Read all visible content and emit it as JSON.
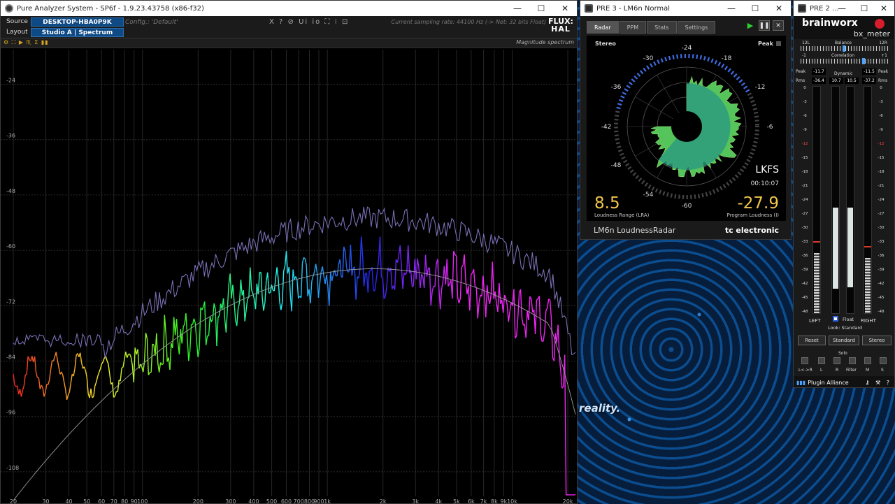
{
  "desktop": {
    "caption": "reality."
  },
  "pure_analyzer": {
    "title": "Pure Analyzer System - SP6f - 1.9.23.43758 (x86-f32)",
    "source_label": "Source",
    "source_value": "DESKTOP-HBA0P9K",
    "layout_label": "Layout",
    "layout_value": "Studio A | Spectrum",
    "config": "Config.: 'Default'",
    "tools": "X ? ⊘ Ui io ⛶ ⁝ ⊡",
    "sampling": "Current sampling rate: 44100 Hz (-> Net: 32 bits Float)",
    "logo_top": "FLUX:",
    "logo_bottom": "HAL",
    "toolbar_icons": "⚙ ⛶ ▶ ♏ Σ ▮▮",
    "mode": "Magnitude spectrum",
    "y_ticks": [
      "-24",
      "-36",
      "-48",
      "-60",
      "-72",
      "-84",
      "-96",
      "-108"
    ],
    "x_ticks": [
      "20",
      "30",
      "40",
      "50",
      "60",
      "70",
      "80",
      "90",
      "100",
      "200",
      "300",
      "400",
      "500",
      "600",
      "700",
      "800",
      "900",
      "1k",
      "2k",
      "3k",
      "4k",
      "5k",
      "6k",
      "7k",
      "8k",
      "9k",
      "10k",
      "20k"
    ]
  },
  "lm6": {
    "title": "PRE 3 - LM6n Normal",
    "tabs": [
      "Radar",
      "PPM",
      "Stats",
      "Settings"
    ],
    "stereo": "Stereo",
    "peak": "Peak",
    "ring_labels": [
      "-24",
      "-18",
      "-12",
      "-6",
      "-30",
      "-36",
      "-42",
      "-48",
      "-54",
      "-60"
    ],
    "unit": "LKFS",
    "time": "00:10:07",
    "lra_value": "8.5",
    "lra_label": "Loudness Range (LRA)",
    "program_value": "-27.9",
    "program_label": "Program Loudness (I)",
    "product": "LM6n LoudnessRadar",
    "brand": "tc electronic"
  },
  "bx": {
    "title": "PRE 2 ...",
    "brand": "brainworx",
    "product": "bx_meter",
    "balance_label": "Balance",
    "balance_left": "12L",
    "balance_right": "12R",
    "correlation_label": "Correlation",
    "corr_left": "-1",
    "corr_right": "+1",
    "peak_label": "Peak",
    "rms_label": "Rms",
    "dynamic_label": "Dynamic",
    "left_peak": "-11.7",
    "right_peak": "-11.5",
    "left_rms": "-36.4",
    "right_rms": "-37.2",
    "dyn_left": "10.7",
    "dyn_right": "10.5",
    "left_label": "LEFT",
    "right_label": "RIGHT",
    "float_label": "Float",
    "look_label": "Look: Standard",
    "btn_reset": "Reset",
    "btn_standard": "Standard",
    "btn_stereo": "Stereo",
    "solo_label": "Solo",
    "solo_items": [
      "L<->R",
      "L",
      "R",
      "Filter",
      "M",
      "S"
    ],
    "footer": "Plugin Alliance",
    "left_level": -36,
    "right_level": -37,
    "dyn_level_left": 10.7,
    "dyn_level_right": 10.5
  }
}
